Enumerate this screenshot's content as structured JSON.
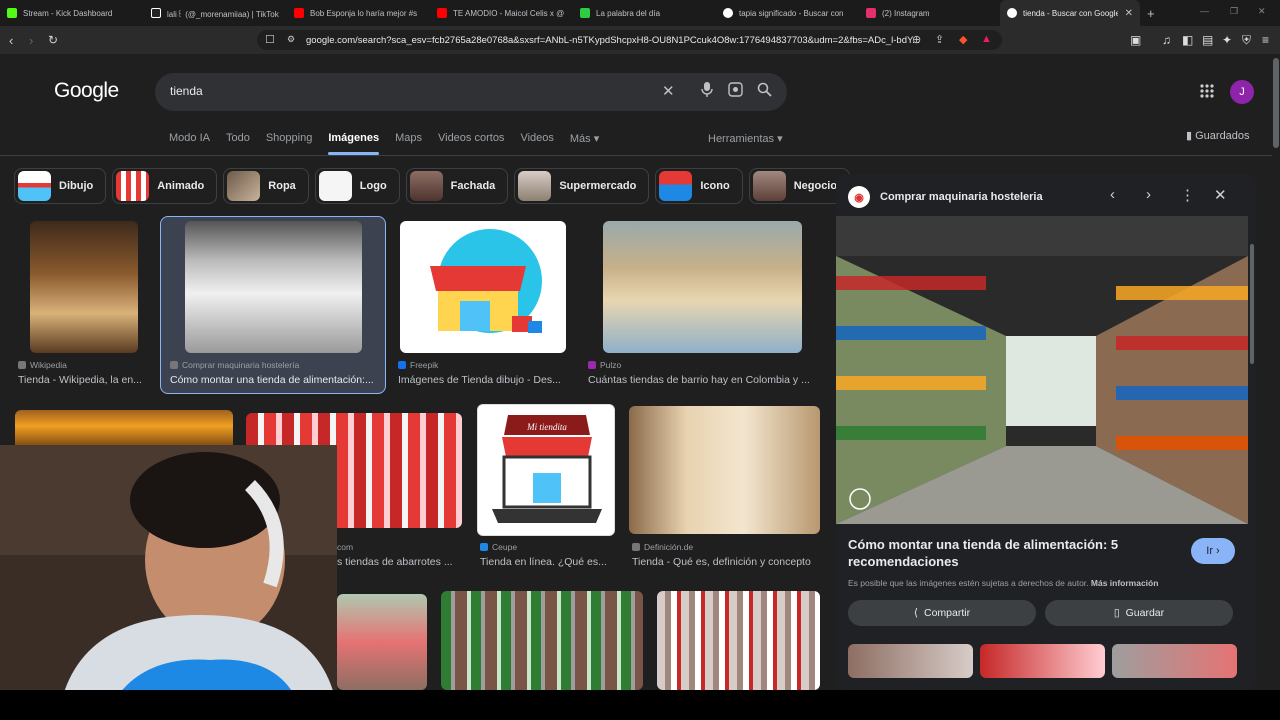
{
  "browser": {
    "tabs": [
      {
        "label": "Stream - Kick Dashboard",
        "color": "#53fc18"
      },
      {
        "label": "lali꒰ (@_morenamiiaa) | TikTok",
        "color": "#ffffff"
      },
      {
        "label": "Bob Esponja lo haría mejor #s",
        "color": "#ff0000"
      },
      {
        "label": "TE AMODIO - Maicol Celis x @",
        "color": "#ff0000"
      },
      {
        "label": "La palabra del día",
        "color": "#2ecc40"
      },
      {
        "label": "tapia significado - Buscar con",
        "color": "#4285f4"
      },
      {
        "label": "(2) Instagram",
        "color": "#e1306c"
      },
      {
        "label": "tienda - Buscar con Google",
        "color": "#4285f4"
      }
    ],
    "new_tab": "+",
    "url": "google.com/search?sca_esv=fcb2765a28e0768a&sxsrf=ANbL-n5TKypdShcpxH8-OU8N1PCcuk4O8w:1776494837703&udm=2&fbs=ADc_l-bdY..."
  },
  "google": {
    "logo": "Google",
    "query": "tienda",
    "avatar_letter": "J",
    "nav_tabs": [
      "Modo IA",
      "Todo",
      "Shopping",
      "Imágenes",
      "Maps",
      "Videos cortos",
      "Videos",
      "Más ▾"
    ],
    "tools": "Herramientas ▾",
    "saved": "Guardados"
  },
  "chips": [
    "Dibujo",
    "Animado",
    "Ropa",
    "Logo",
    "Fachada",
    "Supermercado",
    "Icono",
    "Negocio"
  ],
  "results": [
    {
      "source": "Wikipedia",
      "title": "Tienda - Wikipedia, la en..."
    },
    {
      "source": "Comprar maquinaria hostelería",
      "title": "Cómo montar una tienda de alimentación:..."
    },
    {
      "source": "Freepik",
      "title": "Imágenes de Tienda dibujo - Des..."
    },
    {
      "source": "Pulzo",
      "title": "Cuántas tiendas de barrio hay en Colombia y ..."
    },
    {
      "source": "com",
      "title": "s tiendas de abarrotes ..."
    },
    {
      "source": "Ceupe",
      "title": "Tienda en línea. ¿Qué es..."
    },
    {
      "source": "Definición.de",
      "title": "Tienda - Qué es, definición y concepto"
    }
  ],
  "panel": {
    "source": "Comprar maquinaria hosteleria",
    "title": "Cómo montar una tienda de alimentación: 5 recomendaciones",
    "go_button": "Ir ›",
    "copyright": "Es posible que las imágenes estén sujetas a derechos de autor.",
    "more_info": "Más información",
    "share": "Compartir",
    "save": "Guardar"
  },
  "icons": {
    "search": "⌕",
    "mic": "🎤",
    "lens": "◉",
    "clear": "✕",
    "apps": "⋮⋮⋮",
    "bookmark": "🔖"
  },
  "drawing_text": {
    "mi_tiendita": "Mi tiendita"
  }
}
